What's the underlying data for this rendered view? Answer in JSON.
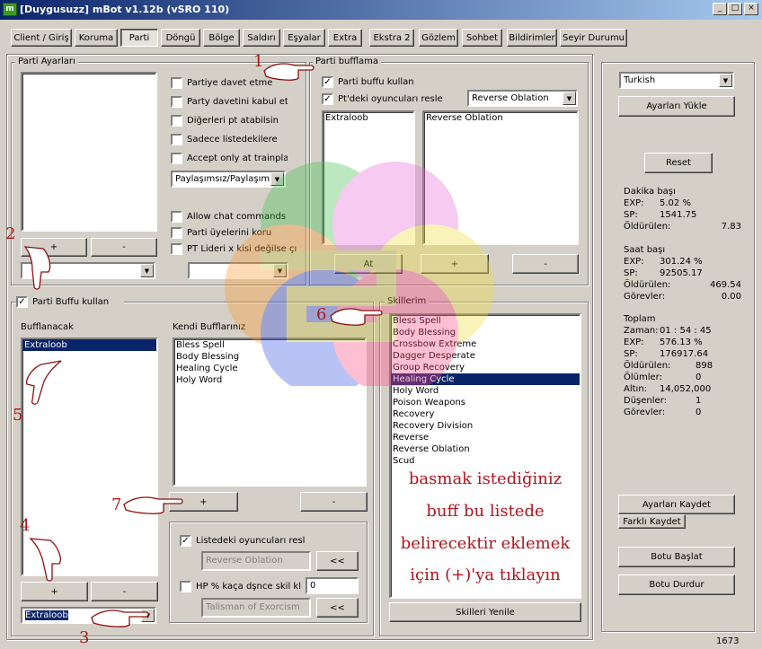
{
  "window": {
    "title": "[Duygusuzz] mBot v1.12b (vSRO 110)",
    "min": "_",
    "max": "□",
    "close": "×",
    "app_icon": "m"
  },
  "tabs": [
    "Client / Giriş",
    "Koruma",
    "Parti",
    "Döngü",
    "Bölge",
    "Saldırı",
    "Eşyalar",
    "Extra",
    "Ekstra 2",
    "Gözlem",
    "Sohbet",
    "Bildirimler",
    "Seyir Durumu"
  ],
  "active_tab": "Parti",
  "parti_ayarlari": {
    "label": "Parti Ayarları",
    "add": "+",
    "remove": "-",
    "checks": [
      "Partiye davet etme",
      "Party davetini kabul etr",
      "Diğerleri pt atabilsin",
      "Sadece listedekilere",
      "Accept only at trainplac"
    ],
    "paylasim": "Paylaşımsız/Paylaşımsı",
    "checks2": [
      "Allow chat commands",
      "Parti üyelerini koru",
      "PT Lideri x kisi değilse çıl"
    ]
  },
  "parti_bufflama": {
    "label": "Parti bufflama",
    "buff_use": "Parti buffu kullan",
    "resle": "Pt'deki oyuncuları resle",
    "resle_skill": "Reverse Oblation",
    "players": [
      "Extraloob"
    ],
    "skills": [
      "Reverse Oblation"
    ],
    "at": "At",
    "add": "+",
    "remove": "-"
  },
  "parti_buffu": {
    "label": "Parti Buffu kullan",
    "bufflanacak": "Bufflanacak",
    "kendi": "Kendi Bufflarınız",
    "targets": [
      "Extraloob"
    ],
    "own_buffs": [
      "Bless Spell",
      "Body Blessing",
      "Healing Cycle",
      "Holy Word"
    ],
    "add": "+",
    "remove": "-",
    "own_add": "+",
    "own_remove": "-",
    "target_select": "Extraloob",
    "list_resle": "Listedeki oyuncuları resl",
    "resle_skill": "Reverse Oblation",
    "arrow_btn": "<<",
    "hp_label": "HP % kaça dşnce skil klı",
    "hp_value": "0",
    "hp_skill": "Talisman of Exorcism",
    "arrow_btn2": "<<"
  },
  "skillerim": {
    "label": "Skillerim",
    "items": [
      "Bless Spell",
      "Body Blessing",
      "Crossbow Extreme",
      "Dagger Desperate",
      "Group Recovery",
      "Healing Cycle",
      "Holy Word",
      "Poison Weapons",
      "Recovery",
      "Recovery Division",
      "Reverse",
      "Reverse Oblation",
      "Scud"
    ],
    "selected": "Healing Cycle",
    "refresh": "Skilleri Yenile"
  },
  "annotation": [
    "basmak istediğiniz",
    "buff bu listede",
    "belirecektir eklemek",
    "için (+)'ya tıklayın"
  ],
  "markers": [
    "1",
    "2",
    "3",
    "4",
    "5",
    "6",
    "7"
  ],
  "right": {
    "language": "Turkish",
    "load": "Ayarları Yükle",
    "reset": "Reset",
    "minute": {
      "title": "Dakika başı",
      "rows": [
        [
          "EXP:",
          "5.02 %"
        ],
        [
          "SP:",
          "1541.75"
        ],
        [
          "Öldürülen:",
          "7.83"
        ]
      ]
    },
    "hour": {
      "title": "Saat başı",
      "rows": [
        [
          "EXP:",
          "301.24 %"
        ],
        [
          "SP:",
          "92505.17"
        ],
        [
          "Öldürülen:",
          "469.54"
        ],
        [
          "Görevler:",
          "0.00"
        ]
      ]
    },
    "total": {
      "title": "Toplam",
      "rows": [
        [
          "Zaman:",
          "01 : 54 : 45"
        ],
        [
          "EXP:",
          "576.13 %"
        ],
        [
          "SP:",
          "176917.64"
        ],
        [
          "Öldürülen:",
          "898"
        ],
        [
          "Ölümler:",
          "0"
        ],
        [
          "Altın:",
          "14,052,000"
        ],
        [
          "Düşenler:",
          "1"
        ],
        [
          "Görevler:",
          "0"
        ]
      ]
    },
    "save": "Ayarları Kaydet",
    "save_as": "Farklı Kaydet",
    "start": "Botu Başlat",
    "stop": "Botu Durdur"
  },
  "status_number": "1673",
  "colors": {
    "title_start": "#0a246a",
    "title_end": "#a6caf0",
    "selection": "#0a246a",
    "annotation": "#b0141e"
  }
}
